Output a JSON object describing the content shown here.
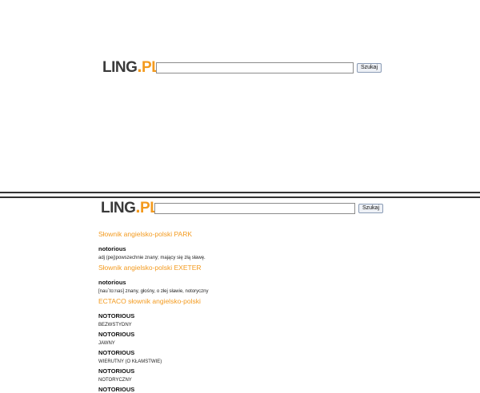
{
  "top": {
    "logo": {
      "ling": "LING",
      "dot": ".",
      "pl": "PL"
    },
    "search": {
      "value": "",
      "placeholder": "",
      "button_label": "Szukaj"
    }
  },
  "bottom": {
    "logo": {
      "ling": "LING",
      "dot": ".",
      "pl": "PL"
    },
    "search": {
      "value": "",
      "placeholder": "",
      "button_label": "Szukaj"
    },
    "sections": [
      {
        "title": "Słownik angielsko-polski PARK",
        "entries": [
          {
            "headword": "notorious",
            "definition": "adj (pej)powszechnie znany; mający się złą sławę."
          }
        ]
      },
      {
        "title": "Słownik angielsko-polski EXETER",
        "entries": [
          {
            "headword": "notorious",
            "definition": "[nau`to:rıas] znany, głośny, o złej sławie, notoryczny"
          }
        ]
      },
      {
        "title": "ECTACO słownik angielsko-polski",
        "entries": [
          {
            "headword": "NOTORIOUS",
            "definition": "BEZWSTYDNY"
          },
          {
            "headword": "NOTORIOUS",
            "definition": "JAWNY"
          },
          {
            "headword": "NOTORIOUS",
            "definition": "WIERUTNY (O KŁAMSTWIE)"
          },
          {
            "headword": "NOTORIOUS",
            "definition": "NOTORYCZNY"
          },
          {
            "headword": "NOTORIOUS",
            "definition": ""
          }
        ]
      }
    ]
  },
  "colors": {
    "brand_orange": "#f39a1e",
    "logo_gray": "#3a3a3a"
  }
}
